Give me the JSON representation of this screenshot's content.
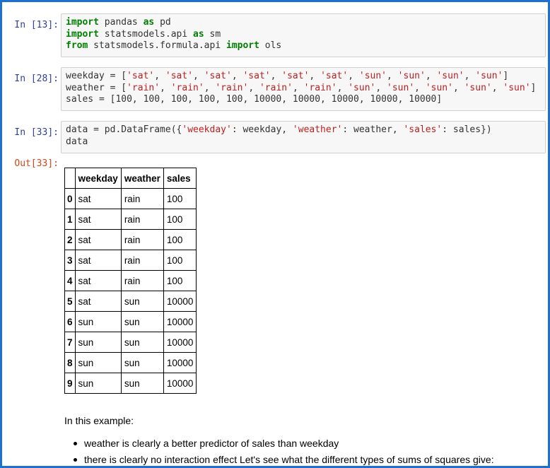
{
  "cells": [
    {
      "prompt": "In [13]:",
      "lines": [
        [
          {
            "t": "import",
            "c": "kw"
          },
          {
            "t": " pandas ",
            "c": "plain"
          },
          {
            "t": "as",
            "c": "kw"
          },
          {
            "t": " pd",
            "c": "plain"
          }
        ],
        [
          {
            "t": "import",
            "c": "kw"
          },
          {
            "t": " statsmodels.api ",
            "c": "plain"
          },
          {
            "t": "as",
            "c": "kw"
          },
          {
            "t": " sm",
            "c": "plain"
          }
        ],
        [
          {
            "t": "from",
            "c": "kw"
          },
          {
            "t": " statsmodels.formula.api ",
            "c": "plain"
          },
          {
            "t": "import",
            "c": "kw"
          },
          {
            "t": " ols",
            "c": "plain"
          }
        ]
      ]
    },
    {
      "prompt": "In [28]:",
      "lines": [
        [
          {
            "t": "weekday = [",
            "c": "plain"
          },
          {
            "t": "'sat'",
            "c": "str"
          },
          {
            "t": ", ",
            "c": "plain"
          },
          {
            "t": "'sat'",
            "c": "str"
          },
          {
            "t": ", ",
            "c": "plain"
          },
          {
            "t": "'sat'",
            "c": "str"
          },
          {
            "t": ", ",
            "c": "plain"
          },
          {
            "t": "'sat'",
            "c": "str"
          },
          {
            "t": ", ",
            "c": "plain"
          },
          {
            "t": "'sat'",
            "c": "str"
          },
          {
            "t": ", ",
            "c": "plain"
          },
          {
            "t": "'sat'",
            "c": "str"
          },
          {
            "t": ", ",
            "c": "plain"
          },
          {
            "t": "'sun'",
            "c": "str"
          },
          {
            "t": ", ",
            "c": "plain"
          },
          {
            "t": "'sun'",
            "c": "str"
          },
          {
            "t": ", ",
            "c": "plain"
          },
          {
            "t": "'sun'",
            "c": "str"
          },
          {
            "t": ", ",
            "c": "plain"
          },
          {
            "t": "'sun'",
            "c": "str"
          },
          {
            "t": "]",
            "c": "plain"
          }
        ],
        [
          {
            "t": "weather = [",
            "c": "plain"
          },
          {
            "t": "'rain'",
            "c": "str"
          },
          {
            "t": ", ",
            "c": "plain"
          },
          {
            "t": "'rain'",
            "c": "str"
          },
          {
            "t": ", ",
            "c": "plain"
          },
          {
            "t": "'rain'",
            "c": "str"
          },
          {
            "t": ", ",
            "c": "plain"
          },
          {
            "t": "'rain'",
            "c": "str"
          },
          {
            "t": ", ",
            "c": "plain"
          },
          {
            "t": "'rain'",
            "c": "str"
          },
          {
            "t": ", ",
            "c": "plain"
          },
          {
            "t": "'sun'",
            "c": "str"
          },
          {
            "t": ", ",
            "c": "plain"
          },
          {
            "t": "'sun'",
            "c": "str"
          },
          {
            "t": ", ",
            "c": "plain"
          },
          {
            "t": "'sun'",
            "c": "str"
          },
          {
            "t": ", ",
            "c": "plain"
          },
          {
            "t": "'sun'",
            "c": "str"
          },
          {
            "t": ", ",
            "c": "plain"
          },
          {
            "t": "'sun'",
            "c": "str"
          },
          {
            "t": "]",
            "c": "plain"
          }
        ],
        [
          {
            "t": "sales = [100, 100, 100, 100, 100, 10000, 10000, 10000, 10000, 10000]",
            "c": "plain"
          }
        ]
      ]
    },
    {
      "prompt": "In [33]:",
      "lines": [
        [
          {
            "t": "data = pd.DataFrame({",
            "c": "plain"
          },
          {
            "t": "'weekday'",
            "c": "str"
          },
          {
            "t": ": weekday, ",
            "c": "plain"
          },
          {
            "t": "'weather'",
            "c": "str"
          },
          {
            "t": ": weather, ",
            "c": "plain"
          },
          {
            "t": "'sales'",
            "c": "str"
          },
          {
            "t": ": sales})",
            "c": "plain"
          }
        ],
        [
          {
            "t": "data",
            "c": "plain"
          }
        ]
      ]
    }
  ],
  "output": {
    "prompt": "Out[33]:",
    "columns": [
      "",
      "weekday",
      "weather",
      "sales"
    ],
    "rows": [
      [
        "0",
        "sat",
        "rain",
        "100"
      ],
      [
        "1",
        "sat",
        "rain",
        "100"
      ],
      [
        "2",
        "sat",
        "rain",
        "100"
      ],
      [
        "3",
        "sat",
        "rain",
        "100"
      ],
      [
        "4",
        "sat",
        "rain",
        "100"
      ],
      [
        "5",
        "sat",
        "sun",
        "10000"
      ],
      [
        "6",
        "sun",
        "sun",
        "10000"
      ],
      [
        "7",
        "sun",
        "sun",
        "10000"
      ],
      [
        "8",
        "sun",
        "sun",
        "10000"
      ],
      [
        "9",
        "sun",
        "sun",
        "10000"
      ]
    ]
  },
  "markdown": {
    "intro": "In this example:",
    "bullets": [
      "weather is clearly a better predictor of sales than weekday",
      "there is clearly no interaction effect Let's see what the different types of sums of squares give:"
    ]
  },
  "colors": {
    "frame": "#1f6fd1",
    "in_prompt": "#303f9f",
    "out_prompt": "#d84315",
    "keyword": "#008000",
    "string": "#ba2121"
  }
}
